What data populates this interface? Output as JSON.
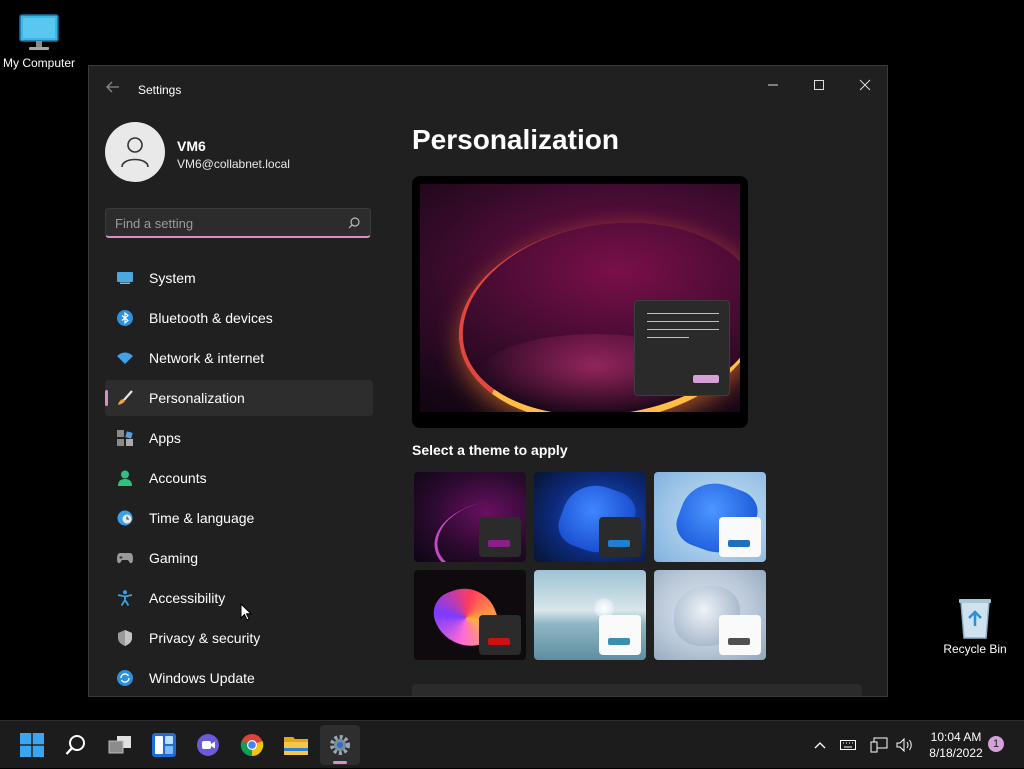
{
  "desktop": {
    "my_computer_label": "My Computer",
    "recycle_bin_label": "Recycle Bin"
  },
  "window": {
    "title": "Settings",
    "accent_color": "#d88fc8",
    "profile": {
      "name": "VM6",
      "email": "VM6@collabnet.local"
    },
    "search": {
      "placeholder": "Find a setting",
      "value": ""
    },
    "nav": {
      "items": [
        {
          "label": "System",
          "icon": "monitor-icon"
        },
        {
          "label": "Bluetooth & devices",
          "icon": "bluetooth-icon"
        },
        {
          "label": "Network & internet",
          "icon": "wifi-icon"
        },
        {
          "label": "Personalization",
          "icon": "brush-icon",
          "active": true
        },
        {
          "label": "Apps",
          "icon": "apps-icon"
        },
        {
          "label": "Accounts",
          "icon": "person-icon"
        },
        {
          "label": "Time & language",
          "icon": "clock-globe-icon"
        },
        {
          "label": "Gaming",
          "icon": "controller-icon"
        },
        {
          "label": "Accessibility",
          "icon": "accessibility-icon"
        },
        {
          "label": "Privacy & security",
          "icon": "shield-icon"
        },
        {
          "label": "Windows Update",
          "icon": "update-icon"
        }
      ]
    },
    "main": {
      "title": "Personalization",
      "themes_label": "Select a theme to apply",
      "themes": [
        {
          "name": "windows-dark-glow",
          "button_color": "#8a1f8a"
        },
        {
          "name": "windows-dark-bloom",
          "button_color": "#1f7fd0"
        },
        {
          "name": "windows-light-bloom",
          "button_color": "#1f6fc0"
        },
        {
          "name": "captured-motion",
          "button_color": "#d01010"
        },
        {
          "name": "sunrise",
          "button_color": "#3a8fb0"
        },
        {
          "name": "flow",
          "button_color": "#505050"
        }
      ]
    }
  },
  "taskbar": {
    "apps": [
      "start-icon",
      "search-icon",
      "task-view-icon",
      "widgets-icon",
      "chat-icon",
      "chrome-icon",
      "file-explorer-icon",
      "settings-icon"
    ],
    "active_app": "settings-icon",
    "time": "10:04 AM",
    "date": "8/18/2022",
    "notification_count": "1"
  }
}
